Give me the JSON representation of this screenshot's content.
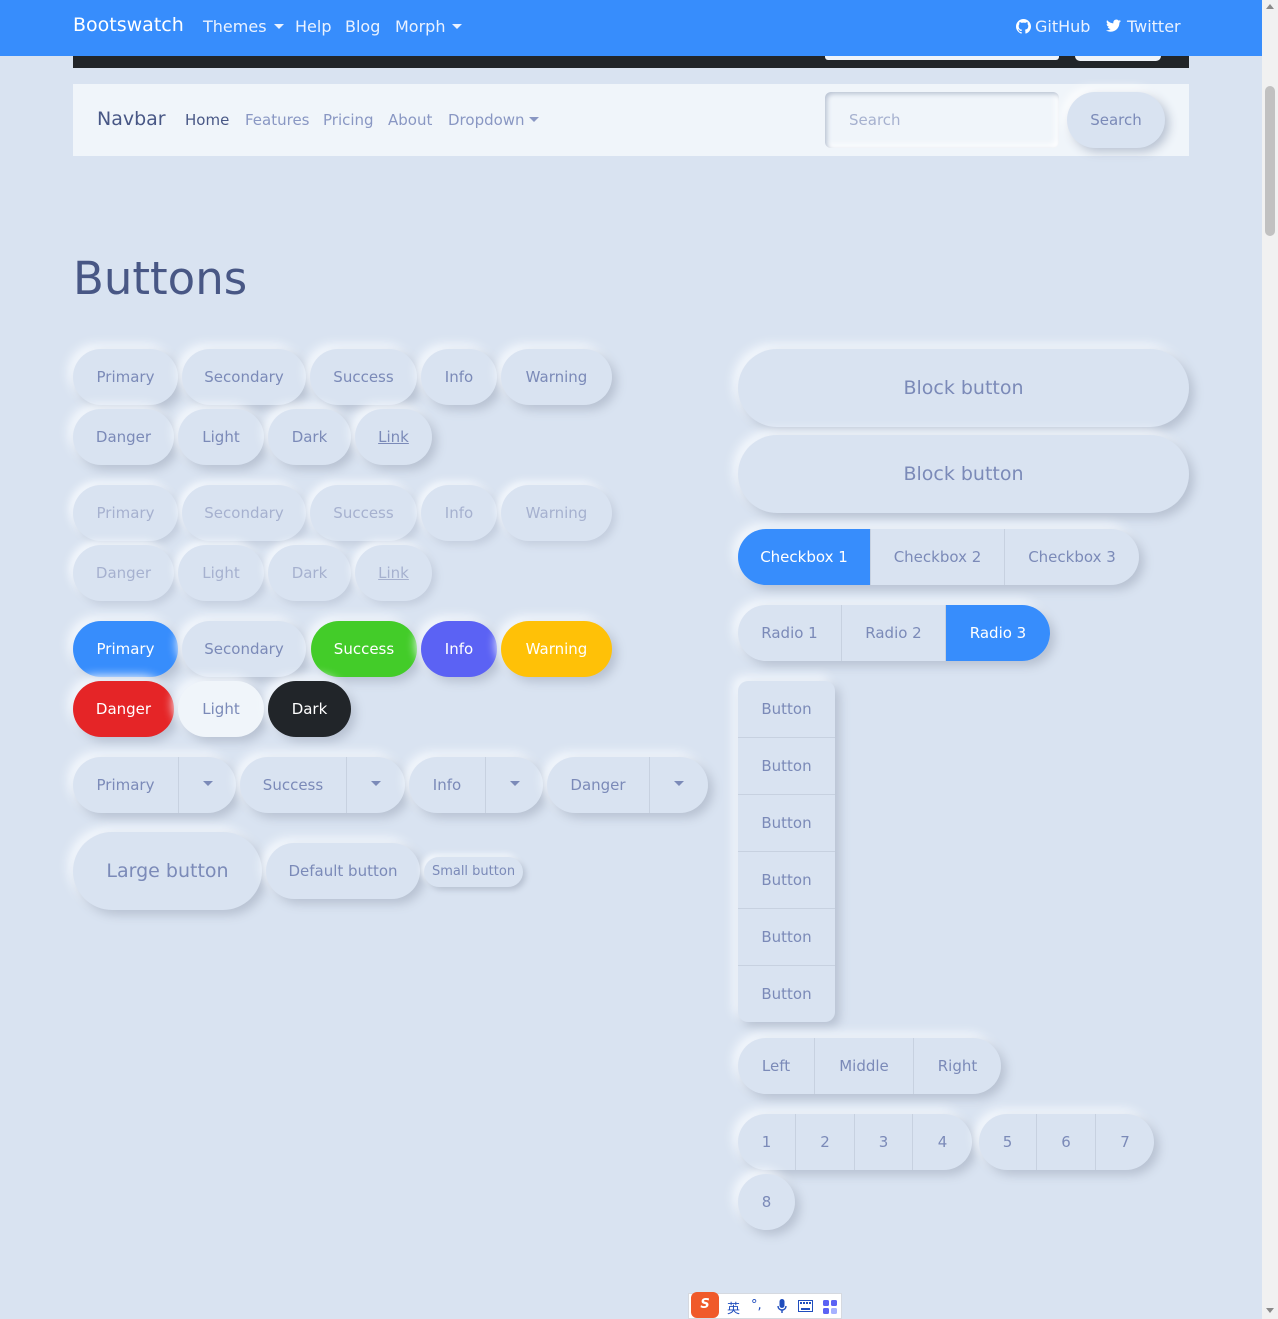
{
  "topnav": {
    "brand": "Bootswatch",
    "links": [
      {
        "label": "Themes",
        "dropdown": true
      },
      {
        "label": "Help",
        "dropdown": false
      },
      {
        "label": "Blog",
        "dropdown": false
      },
      {
        "label": "Morph",
        "dropdown": true
      }
    ],
    "github": "GitHub",
    "twitter": "Twitter"
  },
  "subnav": {
    "brand": "Navbar",
    "links": [
      "Home",
      "Features",
      "Pricing",
      "About",
      "Dropdown"
    ],
    "active": "Home",
    "search_placeholder": "Search",
    "search_button": "Search"
  },
  "section_title": "Buttons",
  "default_buttons": [
    "Primary",
    "Secondary",
    "Success",
    "Info",
    "Warning",
    "Danger",
    "Light",
    "Dark",
    "Link"
  ],
  "disabled_buttons": [
    "Primary",
    "Secondary",
    "Success",
    "Info",
    "Warning",
    "Danger",
    "Light",
    "Dark",
    "Link"
  ],
  "solid_buttons": [
    "Primary",
    "Secondary",
    "Success",
    "Info",
    "Warning",
    "Danger",
    "Light",
    "Dark"
  ],
  "split_buttons": [
    "Primary",
    "Success",
    "Info",
    "Danger"
  ],
  "sizes": {
    "large": "Large button",
    "default": "Default button",
    "small": "Small button"
  },
  "block_buttons": [
    "Block button",
    "Block button"
  ],
  "checkboxes": {
    "items": [
      "Checkbox 1",
      "Checkbox 2",
      "Checkbox 3"
    ],
    "checked": "Checkbox 1"
  },
  "radios": {
    "items": [
      "Radio 1",
      "Radio 2",
      "Radio 3"
    ],
    "selected": "Radio 3"
  },
  "vertical_group": [
    "Button",
    "Button",
    "Button",
    "Button",
    "Button",
    "Button"
  ],
  "lmr_group": [
    "Left",
    "Middle",
    "Right"
  ],
  "pager_group_1": [
    "1",
    "2",
    "3",
    "4"
  ],
  "pager_group_2": [
    "5",
    "6",
    "7"
  ],
  "pager_group_3": [
    "8"
  ],
  "ime": {
    "logo": "S",
    "lang": "英"
  },
  "colors": {
    "primary": "#378dfc",
    "success": "#43cc29",
    "info": "#5b62f4",
    "warning": "#ffc107",
    "danger": "#e52527",
    "dark": "#212529",
    "background": "#d9e3f1"
  }
}
